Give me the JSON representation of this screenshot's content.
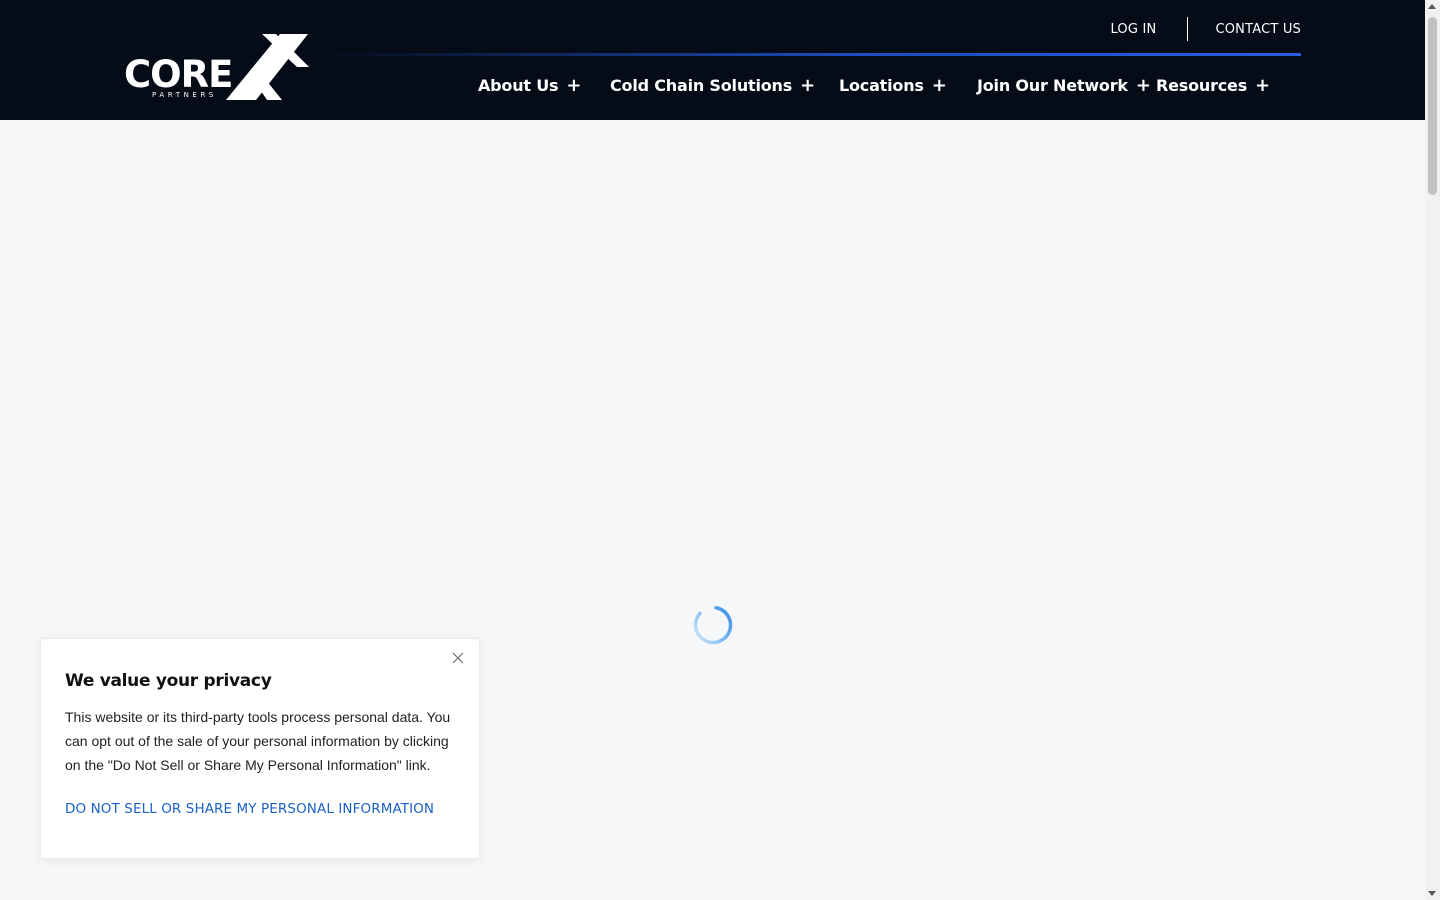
{
  "brand": {
    "logo_word": "CORE",
    "logo_sub": "PARTNERS",
    "colors": {
      "header_bg": "#060b18",
      "accent": "#1d4dbf",
      "link": "#1a62c6",
      "page_bg": "#f5f7f9"
    }
  },
  "topbar": {
    "login_label": "LOG IN",
    "contact_label": "CONTACT US"
  },
  "nav": {
    "items": [
      {
        "label": "About Us",
        "icon": "plus-icon"
      },
      {
        "label": "Cold Chain Solutions",
        "icon": "plus-icon"
      },
      {
        "label": "Locations",
        "icon": "plus-icon"
      },
      {
        "label": "Join Our Network",
        "icon": "plus-icon"
      },
      {
        "label": "Resources",
        "icon": "plus-icon"
      }
    ],
    "expand_glyph": "+"
  },
  "main": {
    "loading_icon": "spinner-icon"
  },
  "privacy": {
    "title": "We value your privacy",
    "body": "This website or its third-party tools process personal data. You can opt out of the sale of your personal information by clicking on the \"Do Not Sell or Share My Personal Information\" link.",
    "link_label": "DO NOT SELL OR SHARE MY PERSONAL INFORMATION",
    "close_icon": "close-icon"
  }
}
